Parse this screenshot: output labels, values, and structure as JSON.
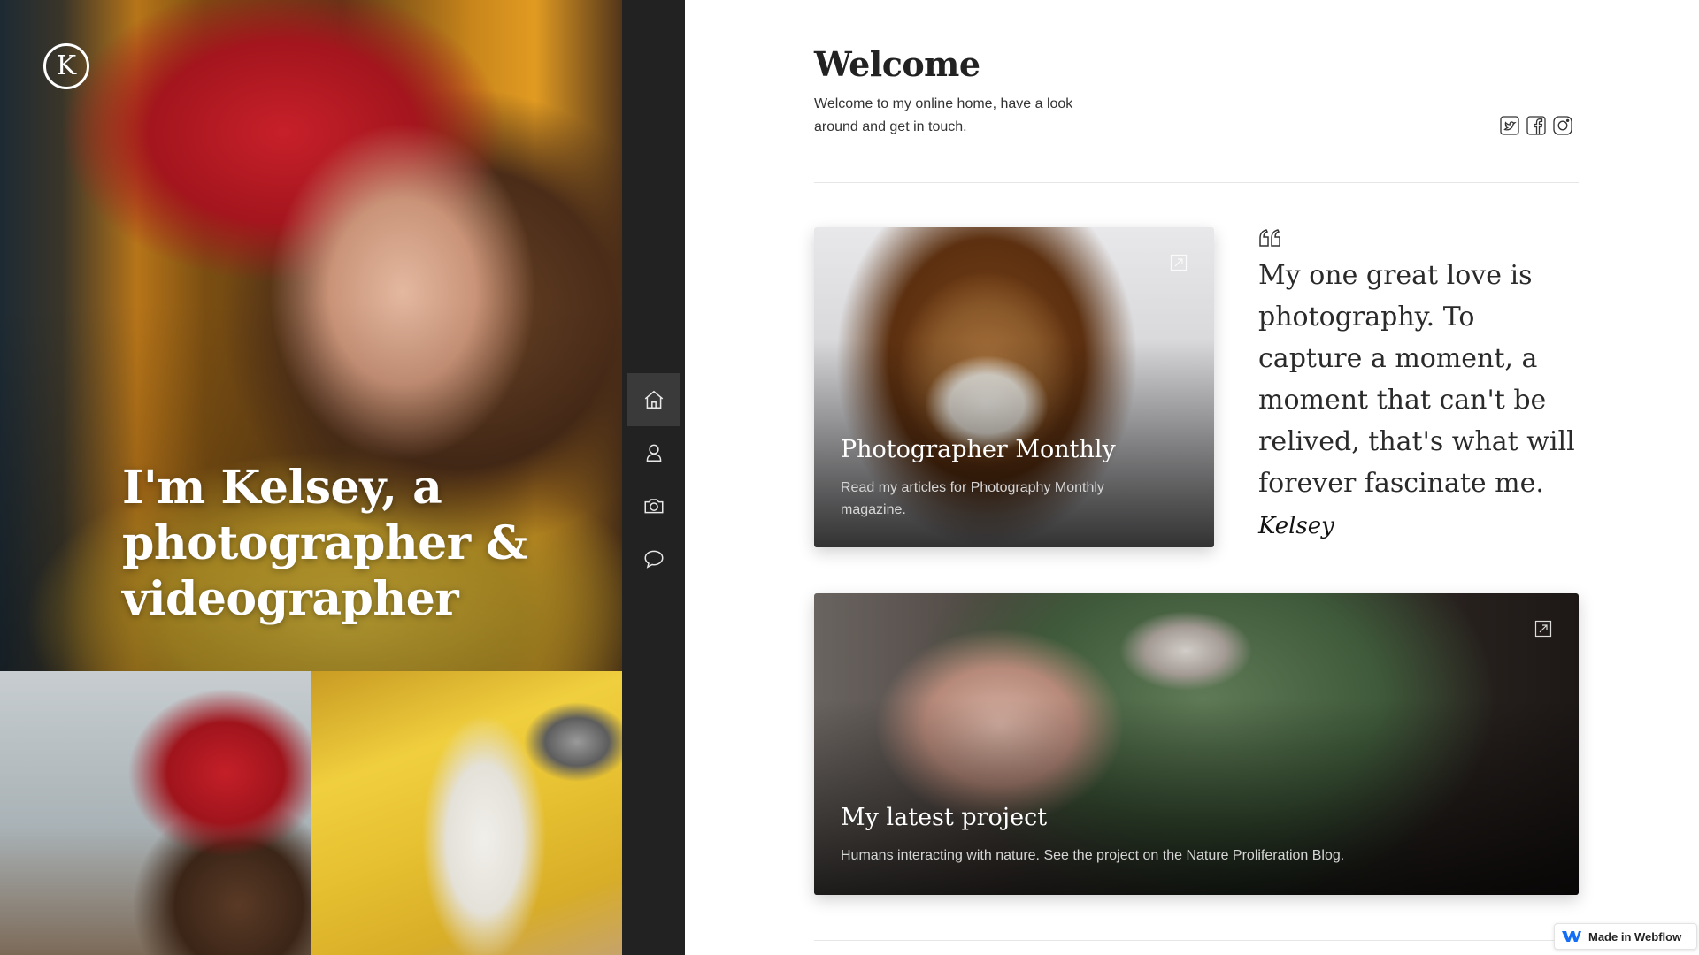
{
  "brand": {
    "logo_letter": "K"
  },
  "hero": {
    "title": "I'm Kelsey, a photographer & videographer"
  },
  "nav": {
    "items": [
      {
        "name": "home",
        "icon": "home-icon",
        "active": true
      },
      {
        "name": "about",
        "icon": "user-icon",
        "active": false
      },
      {
        "name": "portfolio",
        "icon": "camera-icon",
        "active": false
      },
      {
        "name": "contact",
        "icon": "chat-bubble-icon",
        "active": false
      }
    ]
  },
  "welcome": {
    "title": "Welcome",
    "text": "Welcome to my online home, have a look around and get in touch."
  },
  "social": [
    {
      "icon": "twitter-icon"
    },
    {
      "icon": "facebook-icon"
    },
    {
      "icon": "instagram-icon"
    }
  ],
  "cards": [
    {
      "title": "Photographer Monthly",
      "description": "Read my articles for Photography Monthly magazine.",
      "link_icon": "external-link-icon"
    },
    {
      "title": "My latest project",
      "description": "Humans interacting with nature. See the project on the Nature Proliferation Blog.",
      "link_icon": "external-link-icon"
    }
  ],
  "quote": {
    "icon": "quote-icon",
    "text": "My one great love is photography. To capture a moment, a moment that can't be relived, that's what will forever fascinate me.",
    "signature": "Kelsey"
  },
  "badge": {
    "label": "Made in Webflow",
    "icon": "webflow-logo-icon"
  },
  "colors": {
    "rail": "#222222",
    "rail_active": "#3a3a3a",
    "text": "#222222",
    "divider": "#e6e6e6"
  }
}
